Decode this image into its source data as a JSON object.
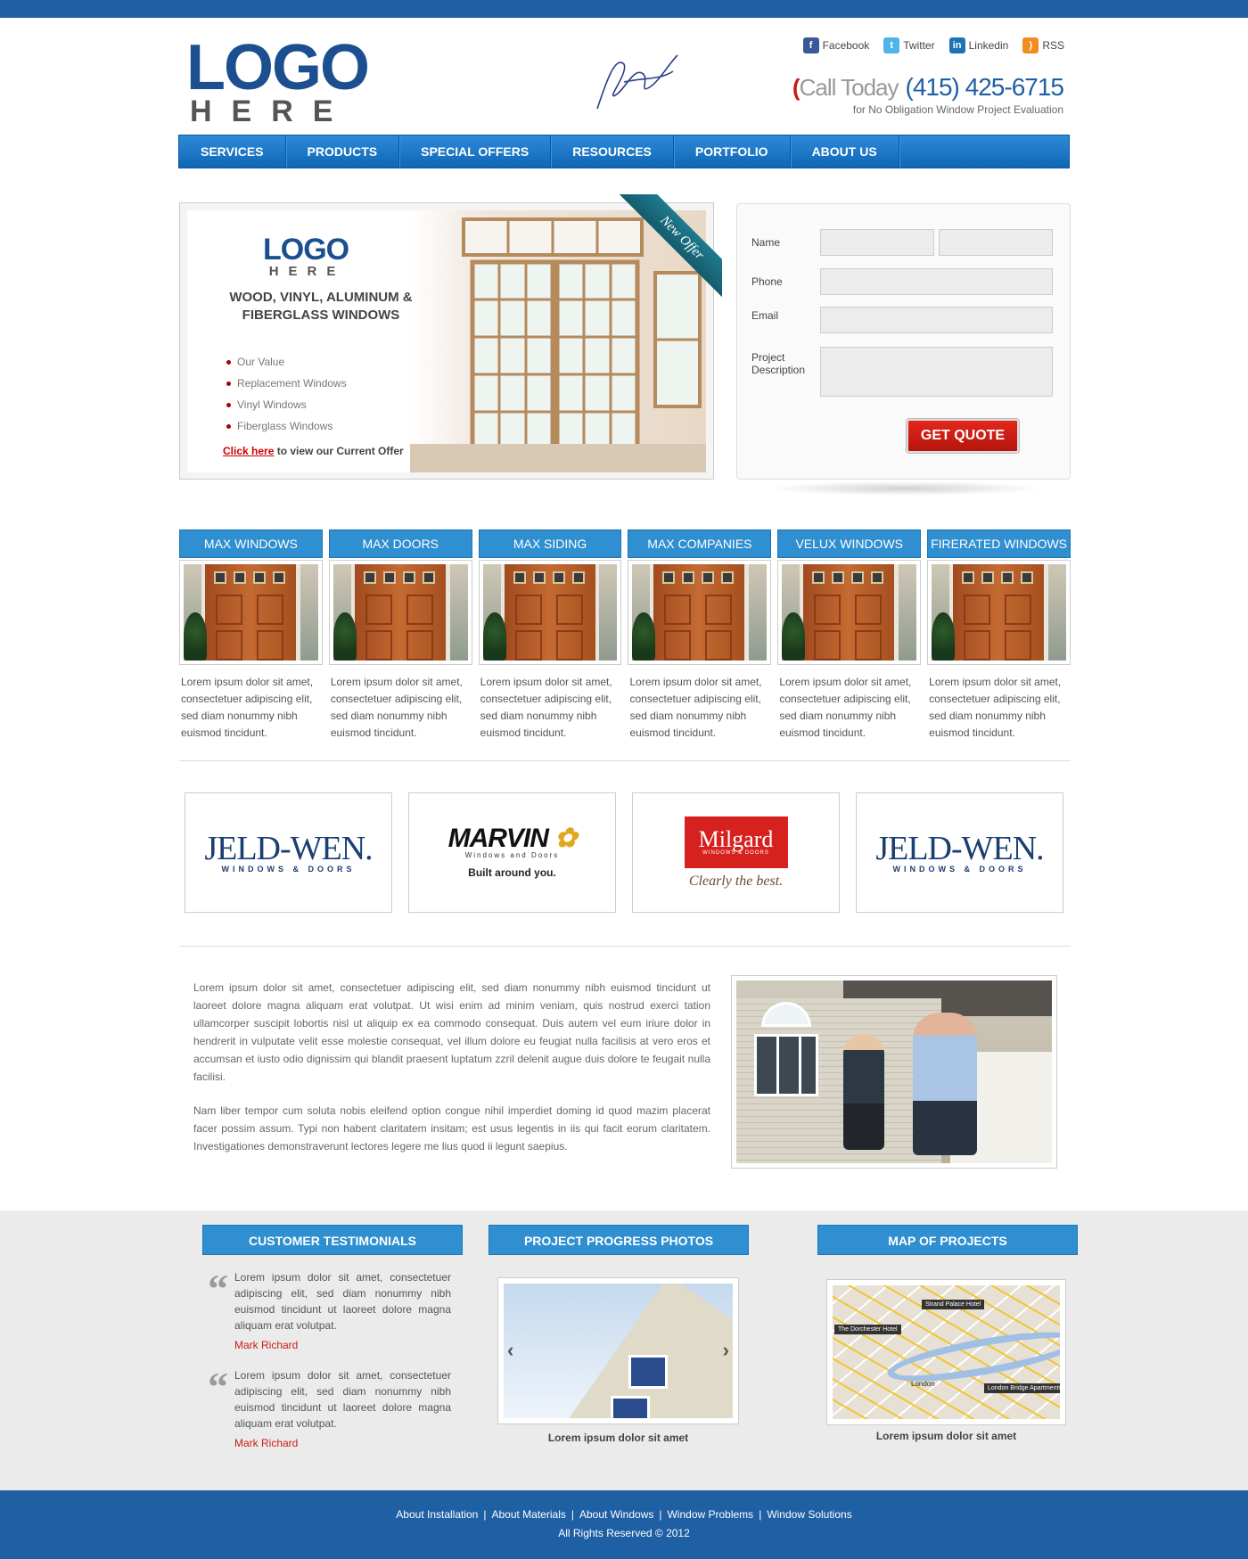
{
  "header": {
    "logo_big": "LOGO",
    "logo_small": "HERE",
    "social": [
      {
        "label": "Facebook",
        "icon": "facebook-icon",
        "color": "#3b5998",
        "glyph": "f"
      },
      {
        "label": "Twitter",
        "icon": "twitter-icon",
        "color": "#4fb4e8",
        "glyph": "t"
      },
      {
        "label": "Linkedin",
        "icon": "linkedin-icon",
        "color": "#1b75b5",
        "glyph": "in"
      },
      {
        "label": "RSS",
        "icon": "rss-icon",
        "color": "#f28c1e",
        "glyph": ")"
      }
    ],
    "call_label": "Call Today",
    "phone": "(415) 425-6715",
    "call_sub": "for No Obligation Window Project Evaluation"
  },
  "nav": [
    "SERVICES",
    "PRODUCTS",
    "SPECIAL OFFERS",
    "RESOURCES",
    "PORTFOLIO",
    "ABOUT US"
  ],
  "hero": {
    "logo_big": "LOGO",
    "logo_small": "HERE",
    "title": "WOOD, VINYL, ALUMINUM & FIBERGLASS WINDOWS",
    "list": [
      "Our Value",
      "Replacement Windows",
      "Vinyl Windows",
      "Fiberglass Windows"
    ],
    "cta_link": "Click here",
    "cta_rest": " to view our Current Offer",
    "ribbon": "New Offer"
  },
  "form": {
    "name_label": "Name",
    "phone_label": "Phone",
    "email_label": "Email",
    "project_label_1": "Project",
    "project_label_2": "Description",
    "submit": "GET QUOTE"
  },
  "products": [
    {
      "title": "MAX WINDOWS",
      "text": "Lorem ipsum dolor sit amet, consectetuer adipiscing elit, sed diam nonummy nibh euismod tincidunt."
    },
    {
      "title": "MAX DOORS",
      "text": "Lorem ipsum dolor sit amet, consectetuer adipiscing elit, sed diam nonummy nibh euismod tincidunt."
    },
    {
      "title": "MAX SIDING",
      "text": "Lorem ipsum dolor sit amet, consectetuer adipiscing elit, sed diam nonummy nibh euismod tincidunt."
    },
    {
      "title": "MAX COMPANIES",
      "text": "Lorem ipsum dolor sit amet, consectetuer adipiscing elit, sed diam nonummy nibh euismod tincidunt."
    },
    {
      "title": "VELUX WINDOWS",
      "text": "Lorem ipsum dolor sit amet, consectetuer adipiscing elit, sed diam nonummy nibh euismod tincidunt."
    },
    {
      "title": "FIRERATED WINDOWS",
      "text": "Lorem ipsum dolor sit amet, consectetuer adipiscing elit, sed diam nonummy nibh euismod tincidunt."
    }
  ],
  "brands": {
    "jeldwen_name": "JELD-WEN.",
    "jeldwen_sub": "WINDOWS & DOORS",
    "marvin_name": "MARVIN",
    "marvin_sub": "Windows and Doors",
    "marvin_tag": "Built around you.",
    "milgard_name": "Milgard",
    "milgard_sub": "WINDOWS & DOORS",
    "milgard_tag": "Clearly the best."
  },
  "about": {
    "p1": "Lorem ipsum dolor sit amet, consectetuer adipiscing elit, sed diam nonummy nibh euismod tincidunt ut laoreet dolore magna aliquam erat volutpat. Ut wisi enim ad minim veniam, quis nostrud exerci tation ullamcorper suscipit lobortis nisl ut aliquip ex ea commodo consequat. Duis autem vel eum iriure dolor in hendrerit in vulputate velit esse molestie consequat, vel illum dolore eu feugiat nulla facilisis at vero eros et accumsan et iusto odio dignissim qui blandit praesent luptatum zzril delenit augue duis dolore te feugait nulla facilisi.",
    "p2": "Nam liber tempor cum soluta nobis eleifend option congue nihil imperdiet doming id quod mazim placerat facer possim assum. Typi non habent claritatem insitam; est usus legentis in iis qui facit eorum claritatem. Investigationes demonstraverunt lectores legere me lius quod ii legunt saepius."
  },
  "testimonials": {
    "title": "CUSTOMER TESTIMONIALS",
    "items": [
      {
        "text": "Lorem ipsum dolor sit amet, consectetuer adipiscing elit, sed diam nonummy nibh euismod tincidunt ut laoreet dolore magna aliquam erat volutpat.",
        "author": "Mark Richard"
      },
      {
        "text": "Lorem ipsum dolor sit amet, consectetuer adipiscing elit, sed diam nonummy nibh euismod tincidunt ut laoreet dolore magna aliquam erat volutpat.",
        "author": "Mark Richard"
      }
    ]
  },
  "progress": {
    "title": "PROJECT PROGRESS PHOTOS",
    "caption": "Lorem ipsum dolor sit amet",
    "prev": "‹",
    "next": "›"
  },
  "map": {
    "title": "MAP OF PROJECTS",
    "caption": "Lorem ipsum dolor sit amet",
    "tags": [
      "Strand Palace Hotel",
      "The Dorchester Hotel",
      "London Bridge Apartments",
      "London"
    ]
  },
  "footer": {
    "links": [
      "About Installation",
      "About Materials",
      "About Windows",
      "Window Problems",
      "Window Solutions"
    ],
    "copyright": "All Rights Reserved © 2012"
  }
}
